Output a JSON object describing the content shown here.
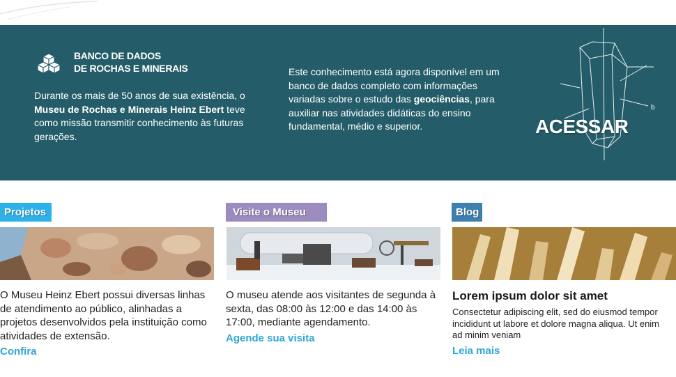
{
  "banner": {
    "title_line1": "BANCO DE DADOS",
    "title_line2": "DE ROCHAS E MINERAIS",
    "icon": "cubes-icon",
    "intro_part1": "Durante os mais de 50 anos de sua existência, o ",
    "intro_bold": "Museu de  Rochas e Minerais Heinz Ebert",
    "intro_part2": " teve como missão transmitir conhecimento às futuras gerações.",
    "info_part1": "Este conhecimento está agora disponível em um banco de  dados completo com informações variadas sobre o estudo das ",
    "info_bold": "geociências",
    "info_part2": ", para auxiliar nas atividades didáticas do ensino fundamental, médio e superior.",
    "cta_label": "ACESSAR",
    "crystal_label": "b",
    "background": "#245d69"
  },
  "sections": {
    "projetos": {
      "tag": "Projetos",
      "tag_color": "#2fb1e8",
      "text": "O Museu Heinz Ebert possui diversas linhas de atendimento ao público, alinhadas a projetos desenvolvidos pela instituição como atividades de extensão.",
      "link": "Confira"
    },
    "visite": {
      "tag": "Visite o Museu",
      "tag_color": "#9b8bbf",
      "text": "O museu atende aos visitantes de segunda à sexta, das 08:00 às 12:00 e das 14:00 às 17:00, mediante agendamento.",
      "link": "Agende sua visita"
    },
    "blog": {
      "tag": "Blog",
      "tag_color": "#3d7faf",
      "title": "Lorem ipsum dolor sit amet",
      "text": "Consectetur adipiscing elit, sed do eiusmod tempor incididunt ut labore et dolore magna aliqua. Ut enim ad minim veniam",
      "link": "Leia mais"
    }
  },
  "colors": {
    "link": "#2fa6d8"
  }
}
